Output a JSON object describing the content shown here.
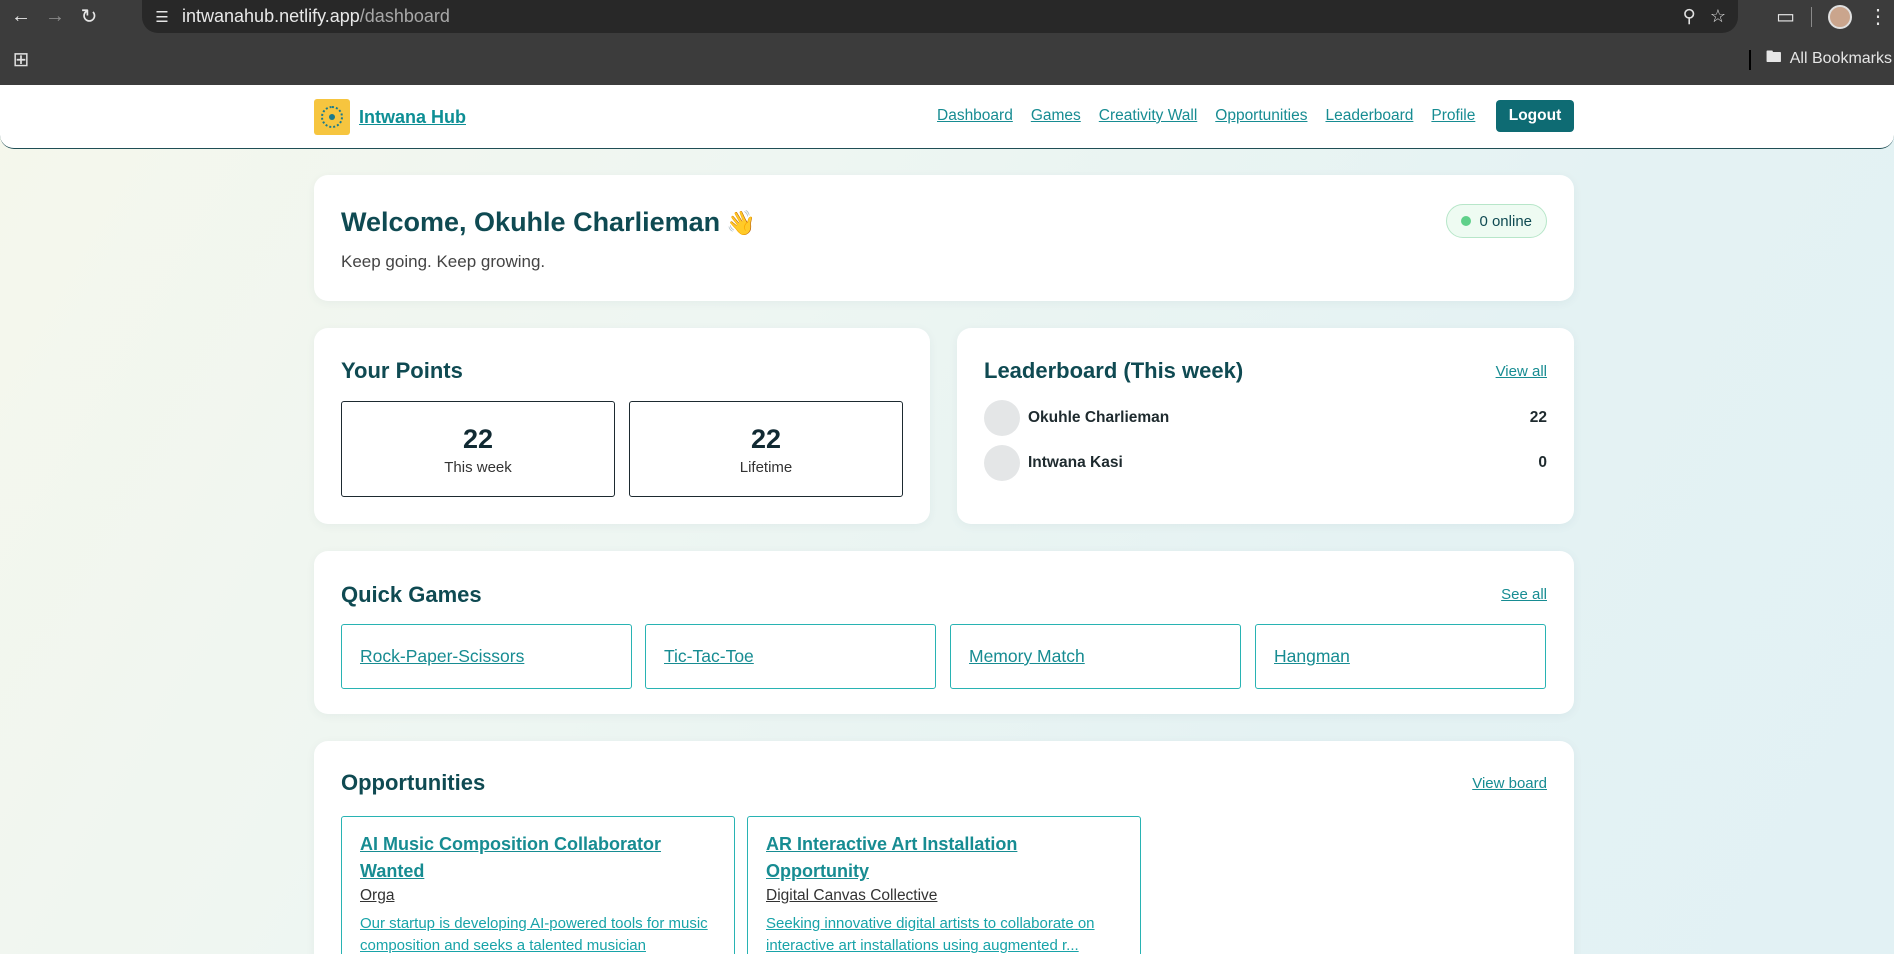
{
  "browser": {
    "url_host": "intwanahub.netlify.app",
    "url_path": "/dashboard",
    "all_bookmarks": "All Bookmarks"
  },
  "nav": {
    "brand": "Intwana Hub",
    "links": [
      "Dashboard",
      "Games",
      "Creativity Wall",
      "Opportunities",
      "Leaderboard",
      "Profile"
    ],
    "logout": "Logout"
  },
  "welcome": {
    "title": "Welcome, Okuhle Charlieman",
    "emoji": "👋",
    "subtitle": "Keep going. Keep growing.",
    "online": "0 online"
  },
  "points": {
    "title": "Your Points",
    "week_value": "22",
    "week_label": "This week",
    "lifetime_value": "22",
    "lifetime_label": "Lifetime"
  },
  "leaderboard": {
    "title": "Leaderboard (This week)",
    "link": "View all",
    "rows": [
      {
        "name": "Okuhle Charlieman",
        "score": "22"
      },
      {
        "name": "Intwana Kasi",
        "score": "0"
      }
    ]
  },
  "games": {
    "title": "Quick Games",
    "link": "See all",
    "items": [
      "Rock-Paper-Scissors",
      "Tic-Tac-Toe",
      "Memory Match",
      "Hangman"
    ]
  },
  "opportunities": {
    "title": "Opportunities",
    "link": "View board",
    "items": [
      {
        "title": "AI Music Composition Collaborator Wanted",
        "org": "Orga",
        "desc": "Our startup is developing AI-powered tools for music composition and seeks a talented musician"
      },
      {
        "title": "AR Interactive Art Installation Opportunity",
        "org": "Digital Canvas Collective",
        "desc": "Seeking innovative digital artists to collaborate on interactive art installations using augmented r..."
      }
    ]
  }
}
